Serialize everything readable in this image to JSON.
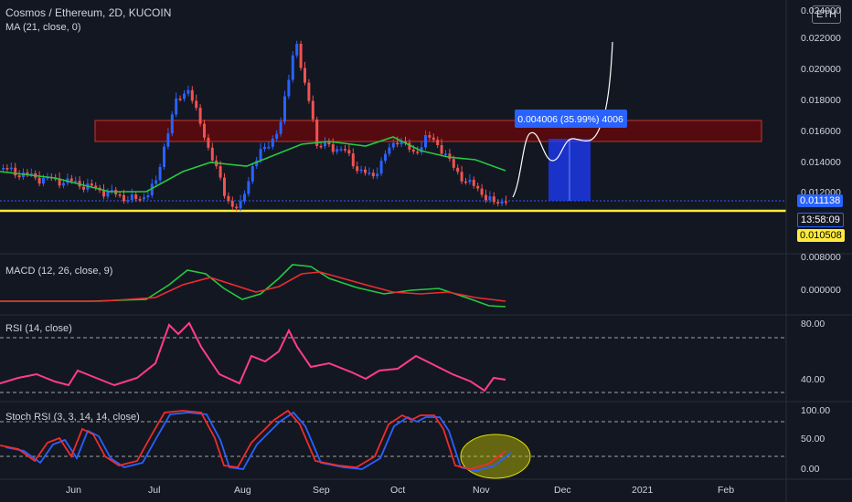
{
  "header": {
    "title": "Cosmos / Ethereum, 2D, KUCOIN",
    "ma_label": "MA (21, close, 0)",
    "currency_badge": "ETH"
  },
  "price_axis": [
    "0.024000",
    "0.022000",
    "0.020000",
    "0.018000",
    "0.016000",
    "0.014000",
    "0.012000",
    "0.008000"
  ],
  "price_tags": {
    "last": "0.011138",
    "countdown": "13:58:09",
    "support": "0.010508"
  },
  "measure_label": "0.004006 (35.99%) 4006",
  "panes": {
    "macd": {
      "label": "MACD (12, 26, close, 9)",
      "axis": [
        "0.000000"
      ]
    },
    "rsi": {
      "label": "RSI (14, close)",
      "axis": [
        "80.00",
        "40.00"
      ]
    },
    "stoch": {
      "label": "Stoch RSI (3, 3, 14, 14, close)",
      "axis": [
        "100.00",
        "50.00",
        "0.00"
      ]
    }
  },
  "time_axis": [
    "Jun",
    "Jul",
    "Aug",
    "Sep",
    "Oct",
    "Nov",
    "Dec",
    "2021",
    "Feb"
  ],
  "colors": {
    "background": "#131722",
    "up": "#2962ff",
    "down": "#ef5350",
    "ma": "#26c940",
    "support_line": "#ffeb3b",
    "resistance_zone": "#8b0000",
    "macd": "#26c940",
    "signal": "#ef2c2c",
    "rsi": "#ff3c8a"
  }
}
